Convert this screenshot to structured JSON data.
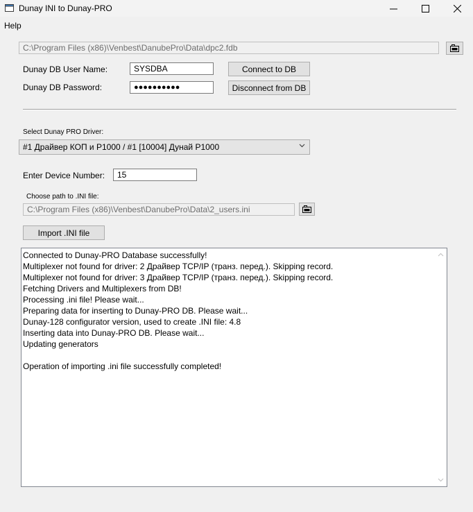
{
  "window": {
    "title": "Dunay INI to Dunay-PRO"
  },
  "menu": {
    "help": "Help"
  },
  "db_path": {
    "value": "C:\\Program Files (x86)\\Venbest\\DanubePro\\Data\\dpc2.fdb"
  },
  "credentials": {
    "user_label": "Dunay DB User Name:",
    "user_value": "SYSDBA",
    "password_label": "Dunay DB Password:",
    "password_value": "●●●●●●●●●●"
  },
  "buttons": {
    "connect": "Connect to DB",
    "disconnect": "Disconnect from DB",
    "import": "Import  .INI file"
  },
  "driver": {
    "label": "Select Dunay PRO Driver:",
    "selected": "#1 Драйвер КОП и Р1000 / #1 [10004] Дунай Р1000"
  },
  "device": {
    "label": "Enter Device Number:",
    "value": "15"
  },
  "ini_path": {
    "label": "Choose path to .INI file:",
    "value": "C:\\Program Files (x86)\\Venbest\\DanubePro\\Data\\2_users.ini"
  },
  "log": {
    "lines": [
      "Connected to Dunay-PRO Database successfully!",
      "Multiplexer not found for driver: 2 Драйвер TCP/IP (транз. перед.). Skipping record.",
      "Multiplexer not found for driver: 3 Драйвер TCP/IP (транз. перед.). Skipping record.",
      "Fetching Drivers and Multiplexers from DB!",
      "Processing .ini file! Please wait...",
      "Preparing data for inserting to Dunay-PRO DB. Please wait...",
      "Dunay-128 configurator version, used to create .INI file: 4.8",
      "Inserting data into Dunay-PRO DB. Please wait...",
      "Updating generators",
      "",
      "Operation of importing .ini file successfully completed!"
    ]
  },
  "icons": {
    "app": "app-icon",
    "minimize": "minimize-icon",
    "maximize": "maximize-icon",
    "close": "close-icon",
    "browse_db": "folder-icon",
    "browse_ini": "folder-icon",
    "combo": "chevron-down-icon",
    "scroll_up": "chevron-up-icon",
    "scroll_down": "chevron-down-icon"
  }
}
